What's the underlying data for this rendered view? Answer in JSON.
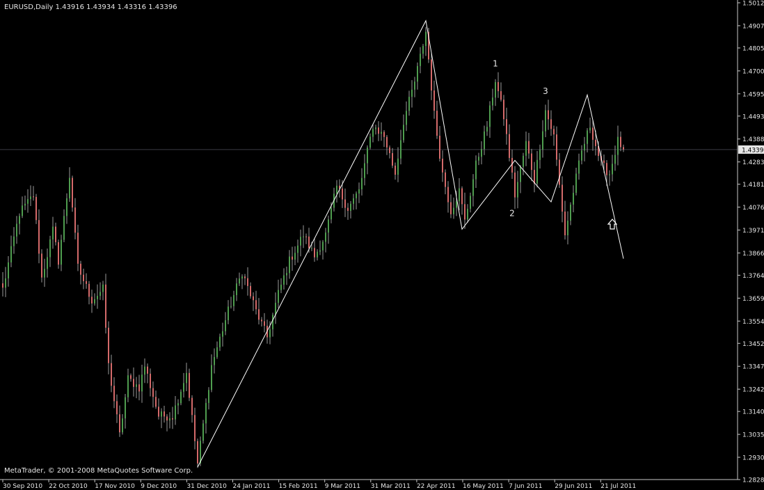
{
  "window": {
    "title": "EURUSD,Daily  1.43916 1.43934 1.43316 1.43396",
    "copyright": "MetaTrader, © 2001-2008 MetaQuotes Software Corp."
  },
  "colors": {
    "background": "#000000",
    "bull_candle": "#4f9d4f",
    "bear_candle": "#d46a6a",
    "wick": "#9a9a9a",
    "axis": "#c8c8c8",
    "text": "#e6e6e6",
    "trendline": "#ffffff",
    "price_line": "#3a3a44"
  },
  "chart_data": {
    "type": "candlestick",
    "symbol": "EURUSD",
    "timeframe": "Daily",
    "ohlc_header": {
      "open": 1.43916,
      "high": 1.43934,
      "low": 1.43316,
      "close": 1.43396
    },
    "current_price": "1.43396",
    "ylim": [
      1.2828,
      1.5012
    ],
    "y_ticks": [
      "1.50120",
      "1.49070",
      "1.48050",
      "1.47000",
      "1.45950",
      "1.44930",
      "1.43880",
      "1.42830",
      "1.41810",
      "1.40760",
      "1.39710",
      "1.38660",
      "1.37640",
      "1.36590",
      "1.35540",
      "1.34520",
      "1.33470",
      "1.32420",
      "1.31400",
      "1.30350",
      "1.29300",
      "1.28280"
    ],
    "x_tick_labels": [
      "30 Sep 2010",
      "22 Oct 2010",
      "17 Nov 2010",
      "9 Dec 2010",
      "31 Dec 2010",
      "24 Jan 2011",
      "15 Feb 2011",
      "9 Mar 2011",
      "31 Mar 2011",
      "22 Apr 2011",
      "16 May 2011",
      "7 Jun 2011",
      "29 Jun 2011",
      "21 Jul 2011"
    ],
    "trendline_points": [
      {
        "bar": 70,
        "price": 1.2885
      },
      {
        "bar": 152,
        "price": 1.493
      },
      {
        "bar": 165,
        "price": 1.3975
      },
      {
        "bar": 184,
        "price": 1.429
      },
      {
        "bar": 197,
        "price": 1.41
      },
      {
        "bar": 210,
        "price": 1.459
      },
      {
        "bar": 223,
        "price": 1.384
      }
    ],
    "wave_labels": [
      {
        "text": "1",
        "bar": 177,
        "price": 1.472
      },
      {
        "text": "2",
        "bar": 183,
        "price": 1.4035
      },
      {
        "text": "3",
        "bar": 195,
        "price": 1.4595
      }
    ],
    "signal_arrow": {
      "bar": 219,
      "price": 1.403,
      "direction": "up"
    },
    "anchors": [
      {
        "bar": 0,
        "price": 1.37
      },
      {
        "bar": 6,
        "price": 1.405
      },
      {
        "bar": 11,
        "price": 1.413
      },
      {
        "bar": 14,
        "price": 1.375
      },
      {
        "bar": 18,
        "price": 1.397
      },
      {
        "bar": 20,
        "price": 1.383
      },
      {
        "bar": 24,
        "price": 1.422
      },
      {
        "bar": 27,
        "price": 1.38
      },
      {
        "bar": 32,
        "price": 1.365
      },
      {
        "bar": 36,
        "price": 1.37
      },
      {
        "bar": 38,
        "price": 1.335
      },
      {
        "bar": 42,
        "price": 1.303
      },
      {
        "bar": 45,
        "price": 1.329
      },
      {
        "bar": 49,
        "price": 1.325
      },
      {
        "bar": 51,
        "price": 1.335
      },
      {
        "bar": 56,
        "price": 1.312
      },
      {
        "bar": 61,
        "price": 1.312
      },
      {
        "bar": 66,
        "price": 1.332
      },
      {
        "bar": 70,
        "price": 1.29
      },
      {
        "bar": 75,
        "price": 1.335
      },
      {
        "bar": 81,
        "price": 1.36
      },
      {
        "bar": 86,
        "price": 1.378
      },
      {
        "bar": 91,
        "price": 1.36
      },
      {
        "bar": 95,
        "price": 1.348
      },
      {
        "bar": 99,
        "price": 1.368
      },
      {
        "bar": 103,
        "price": 1.383
      },
      {
        "bar": 108,
        "price": 1.395
      },
      {
        "bar": 112,
        "price": 1.385
      },
      {
        "bar": 116,
        "price": 1.395
      },
      {
        "bar": 120,
        "price": 1.417
      },
      {
        "bar": 124,
        "price": 1.407
      },
      {
        "bar": 128,
        "price": 1.415
      },
      {
        "bar": 133,
        "price": 1.445
      },
      {
        "bar": 137,
        "price": 1.44
      },
      {
        "bar": 141,
        "price": 1.423
      },
      {
        "bar": 144,
        "price": 1.447
      },
      {
        "bar": 148,
        "price": 1.465
      },
      {
        "bar": 152,
        "price": 1.488
      },
      {
        "bar": 155,
        "price": 1.45
      },
      {
        "bar": 158,
        "price": 1.423
      },
      {
        "bar": 161,
        "price": 1.406
      },
      {
        "bar": 164,
        "price": 1.415
      },
      {
        "bar": 166,
        "price": 1.401
      },
      {
        "bar": 170,
        "price": 1.427
      },
      {
        "bar": 174,
        "price": 1.445
      },
      {
        "bar": 177,
        "price": 1.466
      },
      {
        "bar": 180,
        "price": 1.449
      },
      {
        "bar": 184,
        "price": 1.413
      },
      {
        "bar": 188,
        "price": 1.437
      },
      {
        "bar": 191,
        "price": 1.42
      },
      {
        "bar": 195,
        "price": 1.452
      },
      {
        "bar": 198,
        "price": 1.44
      },
      {
        "bar": 202,
        "price": 1.395
      },
      {
        "bar": 205,
        "price": 1.415
      },
      {
        "bar": 208,
        "price": 1.433
      },
      {
        "bar": 211,
        "price": 1.445
      },
      {
        "bar": 215,
        "price": 1.427
      },
      {
        "bar": 218,
        "price": 1.423
      },
      {
        "bar": 221,
        "price": 1.438
      },
      {
        "bar": 223,
        "price": 1.434
      }
    ]
  }
}
